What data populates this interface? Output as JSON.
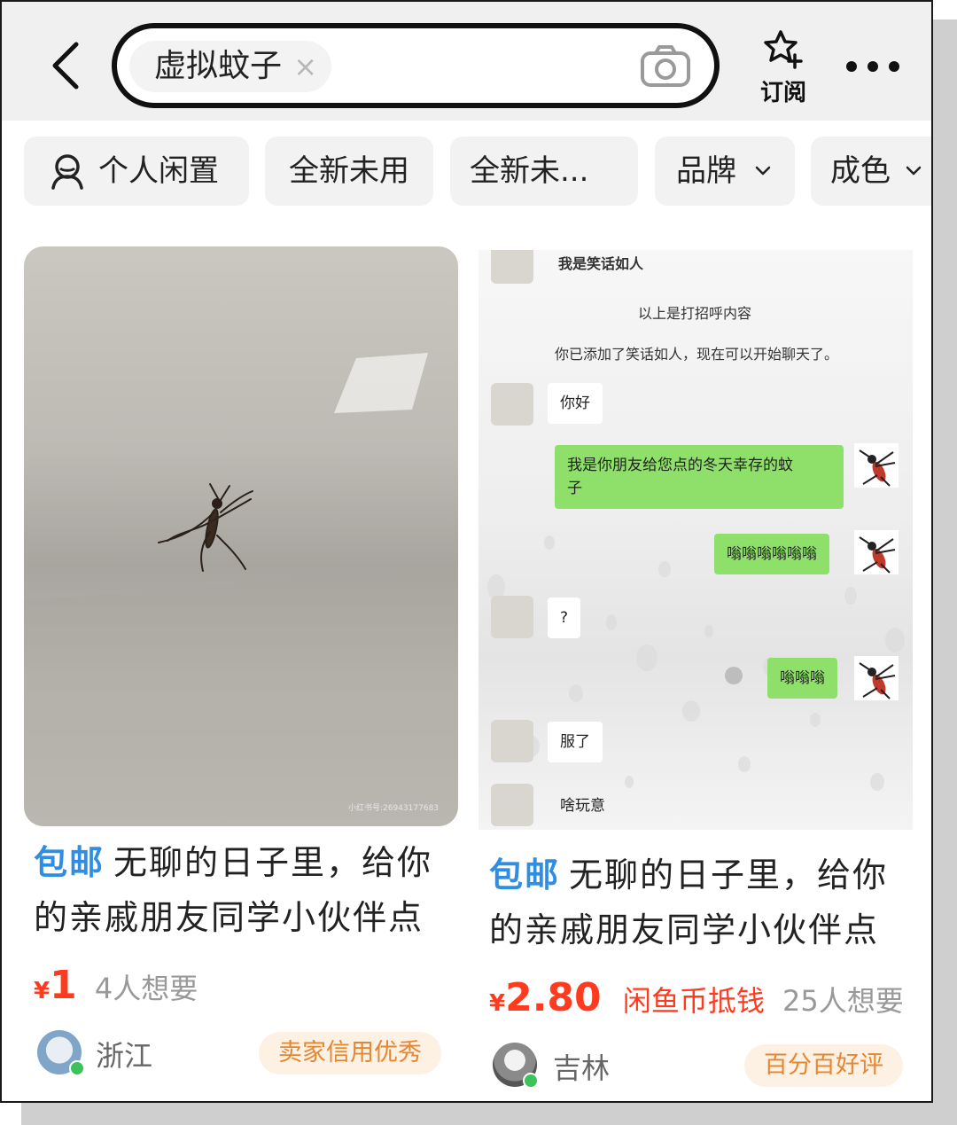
{
  "search": {
    "query": "虚拟蚊子",
    "clear_glyph": "×"
  },
  "header": {
    "subscribe_label": "订阅"
  },
  "icons": {
    "back": "chevron-left-icon",
    "camera": "camera-icon",
    "subscribe": "star-plus-icon",
    "more": "more-dots-icon",
    "personal": "person-icon",
    "dropdown": "chevron-down-icon"
  },
  "filters": [
    {
      "label": "个人闲置"
    },
    {
      "label": "全新未用"
    },
    {
      "label": "全新未..."
    },
    {
      "label": "品牌"
    },
    {
      "label": "成色"
    }
  ],
  "products": [
    {
      "tag": "包邮",
      "title_line1": "无聊的日子里，给你",
      "title_line2": "的亲戚朋友同学小伙伴点",
      "currency": "¥",
      "price": "1",
      "wants": "4人想要",
      "location": "浙江",
      "badge": "卖家信用优秀",
      "image_watermark": "小红书号:26943177683"
    },
    {
      "tag": "包邮",
      "title_line1": "无聊的日子里，给你",
      "title_line2": "的亲戚朋友同学小伙伴点",
      "currency": "¥",
      "price": "2.80",
      "coin_text": "闲鱼币抵钱",
      "wants": "25人想要",
      "location": "吉林",
      "badge": "百分百好评",
      "chat": {
        "top_cut": "我是笑话如人",
        "notice1": "以上是打招呼内容",
        "notice2": "你已添加了笑话如人，现在可以开始聊天了。",
        "msg1": "你好",
        "msg2_line1": "我是你朋友给您点的冬天幸存的蚊",
        "msg2_line2": "子",
        "msg3": "嗡嗡嗡嗡嗡嗡",
        "msg4": "?",
        "msg5": "嗡嗡嗡",
        "msg6": "服了",
        "msg7": "啥玩意"
      }
    }
  ],
  "colors": {
    "accent_blue": "#2f8de4",
    "price_red": "#ff3b1f",
    "badge_orange": "#e58633",
    "chat_green": "#8ee06a"
  }
}
